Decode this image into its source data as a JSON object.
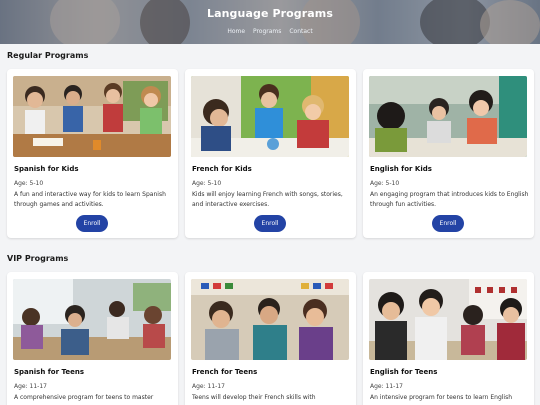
{
  "header": {
    "title": "Language Programs",
    "nav": [
      "Home",
      "Programs",
      "Contact"
    ]
  },
  "sections": [
    {
      "title": "Regular Programs",
      "cards": [
        {
          "title": "Spanish for Kids",
          "age": "Age: 5-10",
          "description": "A fun and interactive way for kids to learn Spanish through games and activities.",
          "button": "Enroll"
        },
        {
          "title": "French for Kids",
          "age": "Age: 5-10",
          "description": "Kids will enjoy learning French with songs, stories, and interactive exercises.",
          "button": "Enroll"
        },
        {
          "title": "English for Kids",
          "age": "Age: 5-10",
          "description": "An engaging program that introduces kids to English through fun activities.",
          "button": "Enroll"
        }
      ]
    },
    {
      "title": "VIP Programs",
      "cards": [
        {
          "title": "Spanish for Teens",
          "age": "Age: 11-17",
          "description": "A comprehensive program for teens to master"
        },
        {
          "title": "French for Teens",
          "age": "Age: 11-17",
          "description": "Teens will develop their French skills with"
        },
        {
          "title": "English for Teens",
          "age": "Age: 11-17",
          "description": "An intensive program for teens to learn English"
        }
      ]
    }
  ]
}
